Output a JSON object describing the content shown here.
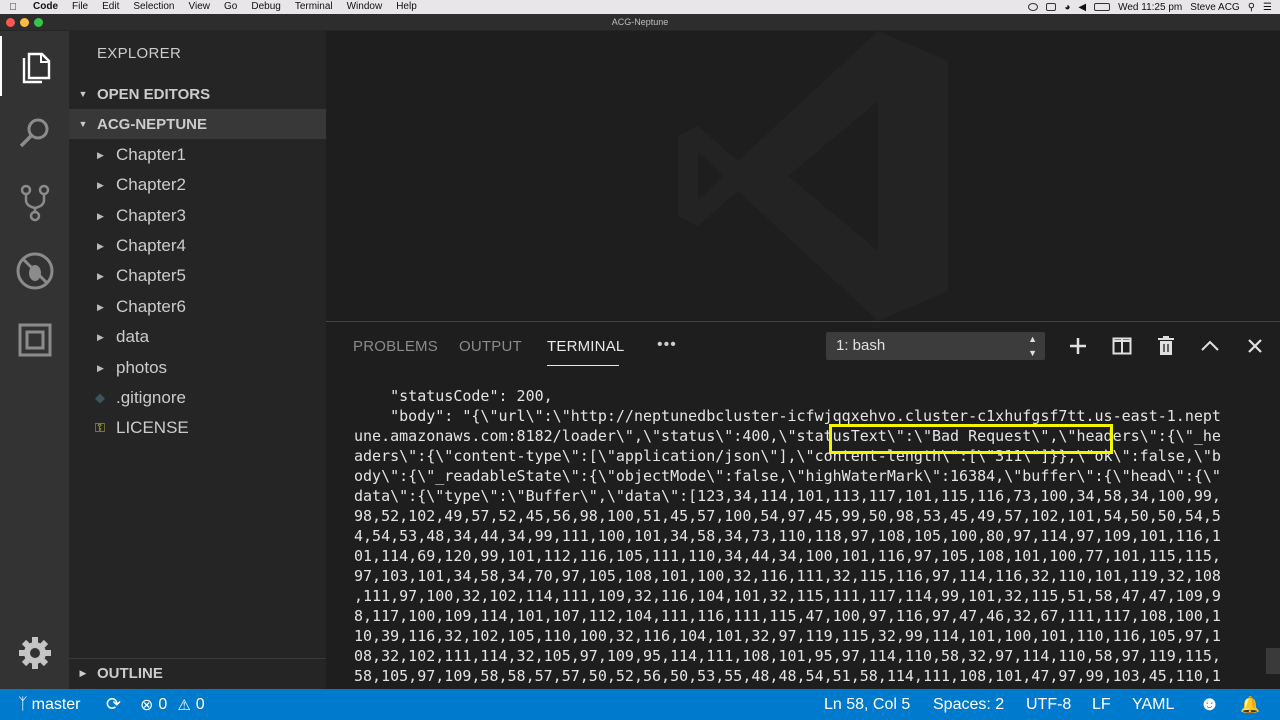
{
  "menubar": {
    "app_name": "Code",
    "items": [
      "File",
      "Edit",
      "Selection",
      "View",
      "Go",
      "Debug",
      "Terminal",
      "Window",
      "Help"
    ],
    "clock": "Wed 11:25 pm",
    "user": "Steve ACG"
  },
  "window": {
    "title": "ACG-Neptune"
  },
  "sidebar": {
    "title": "EXPLORER",
    "open_editors": "OPEN EDITORS",
    "project": "ACG-NEPTUNE",
    "items": [
      {
        "label": "Chapter1",
        "kind": "folder"
      },
      {
        "label": "Chapter2",
        "kind": "folder"
      },
      {
        "label": "Chapter3",
        "kind": "folder"
      },
      {
        "label": "Chapter4",
        "kind": "folder"
      },
      {
        "label": "Chapter5",
        "kind": "folder"
      },
      {
        "label": "Chapter6",
        "kind": "folder"
      },
      {
        "label": "data",
        "kind": "folder"
      },
      {
        "label": "photos",
        "kind": "folder"
      },
      {
        "label": ".gitignore",
        "kind": "file",
        "icon": "git-diamond-icon"
      },
      {
        "label": "LICENSE",
        "kind": "file",
        "icon": "key-icon"
      }
    ],
    "outline": "OUTLINE"
  },
  "panel": {
    "tabs": [
      "PROBLEMS",
      "OUTPUT",
      "TERMINAL"
    ],
    "active_tab": "TERMINAL",
    "more": "•••",
    "terminal_select": "1: bash",
    "terminal_lines": [
      "    \"statusCode\": 200,",
      "    \"body\": \"{\\\"url\\\":\\\"http://neptunedbcluster-icfwjqqxehvo.cluster-c1xhufgsf7tt.us-east-1.nept",
      "une.amazonaws.com:8182/loader\\\",\\\"status\\\":400,\\\"statusText\\\":\\\"Bad Request\\\",\\\"headers\\\":{\\\"_he",
      "aders\\\":{\\\"content-type\\\":[\\\"application/json\\\"],\\\"content-length\\\":[\\\"311\\\"]}},\\\"ok\\\":false,\\\"b",
      "ody\\\":{\\\"_readableState\\\":{\\\"objectMode\\\":false,\\\"highWaterMark\\\":16384,\\\"buffer\\\":{\\\"head\\\":{\\\"",
      "data\\\":{\\\"type\\\":\\\"Buffer\\\",\\\"data\\\":[123,34,114,101,113,117,101,115,116,73,100,34,58,34,100,99,",
      "98,52,102,49,57,52,45,56,98,100,51,45,57,100,54,97,45,99,50,98,53,45,49,57,102,101,54,50,50,54,5",
      "4,54,53,48,34,44,34,99,111,100,101,34,58,34,73,110,118,97,108,105,100,80,97,114,97,109,101,116,1",
      "01,114,69,120,99,101,112,116,105,111,110,34,44,34,100,101,116,97,105,108,101,100,77,101,115,115,",
      "97,103,101,34,58,34,70,97,105,108,101,100,32,116,111,32,115,116,97,114,116,32,110,101,119,32,108",
      ",111,97,100,32,102,114,111,109,32,116,104,101,32,115,111,117,114,99,101,32,115,51,58,47,47,109,9",
      "8,117,100,109,114,101,107,112,104,111,116,111,115,47,100,97,116,97,47,46,32,67,111,117,108,100,1",
      "10,39,116,32,102,105,110,100,32,116,104,101,32,97,119,115,32,99,114,101,100,101,110,116,105,97,1",
      "08,32,102,111,114,32,105,97,109,95,114,111,108,101,95,97,114,110,58,32,97,114,110,58,97,119,115,",
      "58,105,97,109,58,58,57,57,50,52,56,50,53,55,48,48,54,51,58,114,111,108,101,47,97,99,103,45,110,1"
    ]
  },
  "statusbar": {
    "branch": "master",
    "errors": "0",
    "warnings": "0",
    "position": "Ln 58, Col 5",
    "spaces": "Spaces: 2",
    "encoding": "UTF-8",
    "eol": "LF",
    "language": "YAML"
  },
  "colors": {
    "statusbar": "#007acc",
    "activitybar": "#333333",
    "sidebar": "#252526",
    "editor": "#1e1e1e",
    "highlight": "#f5f500"
  }
}
